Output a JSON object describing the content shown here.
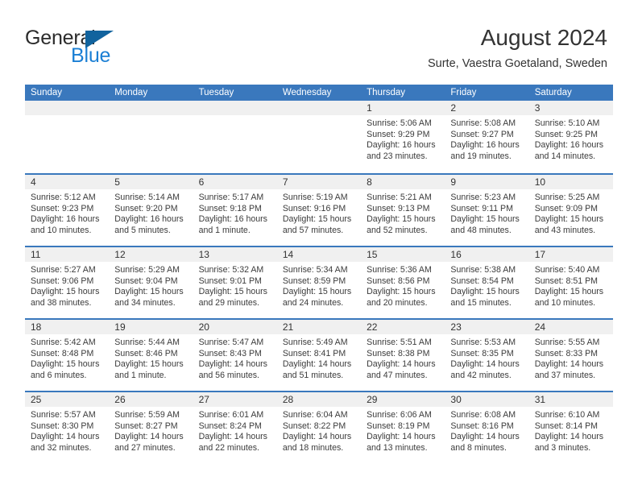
{
  "brand": {
    "name_part1": "General",
    "name_part2": "Blue",
    "accent_color": "#1b7fd4",
    "triangle_color": "#11639e"
  },
  "header": {
    "title": "August 2024",
    "subtitle": "Surte, Vaestra Goetaland, Sweden"
  },
  "theme": {
    "header_blue": "#3a78bd",
    "day_band_gray": "#f0f0f0",
    "text_color": "#333333"
  },
  "calendar": {
    "weekdays": [
      "Sunday",
      "Monday",
      "Tuesday",
      "Wednesday",
      "Thursday",
      "Friday",
      "Saturday"
    ],
    "weeks": [
      [
        {
          "day": "",
          "lines": []
        },
        {
          "day": "",
          "lines": []
        },
        {
          "day": "",
          "lines": []
        },
        {
          "day": "",
          "lines": []
        },
        {
          "day": "1",
          "lines": [
            "Sunrise: 5:06 AM",
            "Sunset: 9:29 PM",
            "Daylight: 16 hours",
            "and 23 minutes."
          ]
        },
        {
          "day": "2",
          "lines": [
            "Sunrise: 5:08 AM",
            "Sunset: 9:27 PM",
            "Daylight: 16 hours",
            "and 19 minutes."
          ]
        },
        {
          "day": "3",
          "lines": [
            "Sunrise: 5:10 AM",
            "Sunset: 9:25 PM",
            "Daylight: 16 hours",
            "and 14 minutes."
          ]
        }
      ],
      [
        {
          "day": "4",
          "lines": [
            "Sunrise: 5:12 AM",
            "Sunset: 9:23 PM",
            "Daylight: 16 hours",
            "and 10 minutes."
          ]
        },
        {
          "day": "5",
          "lines": [
            "Sunrise: 5:14 AM",
            "Sunset: 9:20 PM",
            "Daylight: 16 hours",
            "and 5 minutes."
          ]
        },
        {
          "day": "6",
          "lines": [
            "Sunrise: 5:17 AM",
            "Sunset: 9:18 PM",
            "Daylight: 16 hours",
            "and 1 minute."
          ]
        },
        {
          "day": "7",
          "lines": [
            "Sunrise: 5:19 AM",
            "Sunset: 9:16 PM",
            "Daylight: 15 hours",
            "and 57 minutes."
          ]
        },
        {
          "day": "8",
          "lines": [
            "Sunrise: 5:21 AM",
            "Sunset: 9:13 PM",
            "Daylight: 15 hours",
            "and 52 minutes."
          ]
        },
        {
          "day": "9",
          "lines": [
            "Sunrise: 5:23 AM",
            "Sunset: 9:11 PM",
            "Daylight: 15 hours",
            "and 48 minutes."
          ]
        },
        {
          "day": "10",
          "lines": [
            "Sunrise: 5:25 AM",
            "Sunset: 9:09 PM",
            "Daylight: 15 hours",
            "and 43 minutes."
          ]
        }
      ],
      [
        {
          "day": "11",
          "lines": [
            "Sunrise: 5:27 AM",
            "Sunset: 9:06 PM",
            "Daylight: 15 hours",
            "and 38 minutes."
          ]
        },
        {
          "day": "12",
          "lines": [
            "Sunrise: 5:29 AM",
            "Sunset: 9:04 PM",
            "Daylight: 15 hours",
            "and 34 minutes."
          ]
        },
        {
          "day": "13",
          "lines": [
            "Sunrise: 5:32 AM",
            "Sunset: 9:01 PM",
            "Daylight: 15 hours",
            "and 29 minutes."
          ]
        },
        {
          "day": "14",
          "lines": [
            "Sunrise: 5:34 AM",
            "Sunset: 8:59 PM",
            "Daylight: 15 hours",
            "and 24 minutes."
          ]
        },
        {
          "day": "15",
          "lines": [
            "Sunrise: 5:36 AM",
            "Sunset: 8:56 PM",
            "Daylight: 15 hours",
            "and 20 minutes."
          ]
        },
        {
          "day": "16",
          "lines": [
            "Sunrise: 5:38 AM",
            "Sunset: 8:54 PM",
            "Daylight: 15 hours",
            "and 15 minutes."
          ]
        },
        {
          "day": "17",
          "lines": [
            "Sunrise: 5:40 AM",
            "Sunset: 8:51 PM",
            "Daylight: 15 hours",
            "and 10 minutes."
          ]
        }
      ],
      [
        {
          "day": "18",
          "lines": [
            "Sunrise: 5:42 AM",
            "Sunset: 8:48 PM",
            "Daylight: 15 hours",
            "and 6 minutes."
          ]
        },
        {
          "day": "19",
          "lines": [
            "Sunrise: 5:44 AM",
            "Sunset: 8:46 PM",
            "Daylight: 15 hours",
            "and 1 minute."
          ]
        },
        {
          "day": "20",
          "lines": [
            "Sunrise: 5:47 AM",
            "Sunset: 8:43 PM",
            "Daylight: 14 hours",
            "and 56 minutes."
          ]
        },
        {
          "day": "21",
          "lines": [
            "Sunrise: 5:49 AM",
            "Sunset: 8:41 PM",
            "Daylight: 14 hours",
            "and 51 minutes."
          ]
        },
        {
          "day": "22",
          "lines": [
            "Sunrise: 5:51 AM",
            "Sunset: 8:38 PM",
            "Daylight: 14 hours",
            "and 47 minutes."
          ]
        },
        {
          "day": "23",
          "lines": [
            "Sunrise: 5:53 AM",
            "Sunset: 8:35 PM",
            "Daylight: 14 hours",
            "and 42 minutes."
          ]
        },
        {
          "day": "24",
          "lines": [
            "Sunrise: 5:55 AM",
            "Sunset: 8:33 PM",
            "Daylight: 14 hours",
            "and 37 minutes."
          ]
        }
      ],
      [
        {
          "day": "25",
          "lines": [
            "Sunrise: 5:57 AM",
            "Sunset: 8:30 PM",
            "Daylight: 14 hours",
            "and 32 minutes."
          ]
        },
        {
          "day": "26",
          "lines": [
            "Sunrise: 5:59 AM",
            "Sunset: 8:27 PM",
            "Daylight: 14 hours",
            "and 27 minutes."
          ]
        },
        {
          "day": "27",
          "lines": [
            "Sunrise: 6:01 AM",
            "Sunset: 8:24 PM",
            "Daylight: 14 hours",
            "and 22 minutes."
          ]
        },
        {
          "day": "28",
          "lines": [
            "Sunrise: 6:04 AM",
            "Sunset: 8:22 PM",
            "Daylight: 14 hours",
            "and 18 minutes."
          ]
        },
        {
          "day": "29",
          "lines": [
            "Sunrise: 6:06 AM",
            "Sunset: 8:19 PM",
            "Daylight: 14 hours",
            "and 13 minutes."
          ]
        },
        {
          "day": "30",
          "lines": [
            "Sunrise: 6:08 AM",
            "Sunset: 8:16 PM",
            "Daylight: 14 hours",
            "and 8 minutes."
          ]
        },
        {
          "day": "31",
          "lines": [
            "Sunrise: 6:10 AM",
            "Sunset: 8:14 PM",
            "Daylight: 14 hours",
            "and 3 minutes."
          ]
        }
      ]
    ]
  }
}
